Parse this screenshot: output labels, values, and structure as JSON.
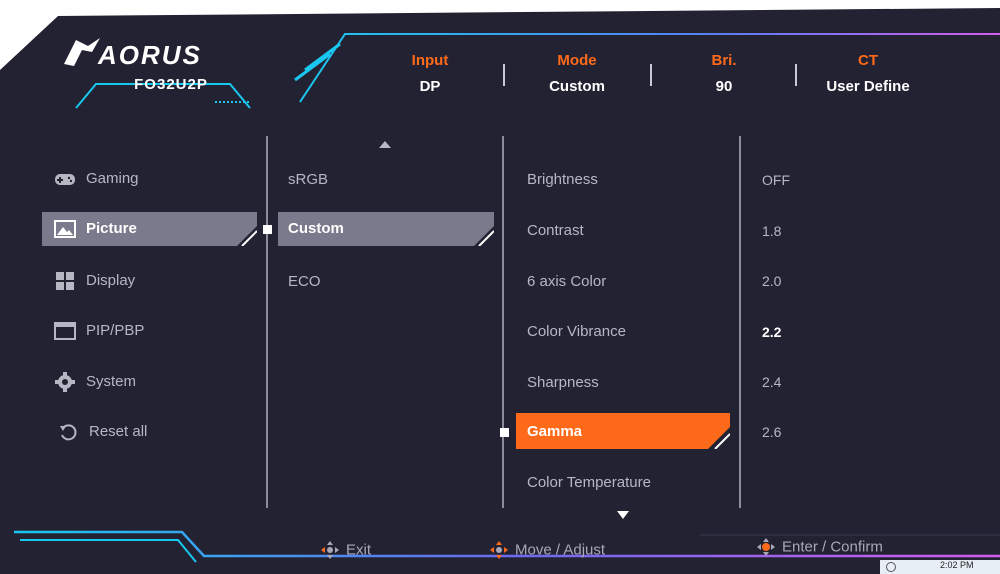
{
  "brand": {
    "logo_text": "AORUS",
    "model": "FO32U2P"
  },
  "header": {
    "items": [
      {
        "label": "Input",
        "value": "DP"
      },
      {
        "label": "Mode",
        "value": "Custom"
      },
      {
        "label": "Bri.",
        "value": "90"
      },
      {
        "label": "CT",
        "value": "User Define"
      }
    ]
  },
  "main_menu": {
    "items": [
      {
        "label": "Gaming",
        "icon": "gamepad-icon"
      },
      {
        "label": "Picture",
        "icon": "picture-icon"
      },
      {
        "label": "Display",
        "icon": "grid-icon"
      },
      {
        "label": "PIP/PBP",
        "icon": "pip-icon"
      },
      {
        "label": "System",
        "icon": "gear-icon"
      },
      {
        "label": "Reset all",
        "icon": "reset-icon"
      }
    ],
    "selected": "Picture"
  },
  "picture_modes": {
    "items": [
      "sRGB",
      "Custom",
      "ECO"
    ],
    "selected": "Custom"
  },
  "settings": {
    "items": [
      "Brightness",
      "Contrast",
      "6 axis Color",
      "Color Vibrance",
      "Sharpness",
      "Gamma",
      "Color Temperature"
    ],
    "selected": "Gamma"
  },
  "gamma_options": {
    "items": [
      "OFF",
      "1.8",
      "2.0",
      "2.2",
      "2.4",
      "2.6"
    ],
    "current": "2.2"
  },
  "footer": {
    "exit": "Exit",
    "move": "Move / Adjust",
    "enter": "Enter / Confirm"
  },
  "taskbar": {
    "time": "2:02 PM"
  },
  "colors": {
    "background": "#232232",
    "accent_orange": "#ff6a1a",
    "accent_cyan": "#19c8f0",
    "accent_magenta": "#d45cf0",
    "selected_gray": "#7a7a8c"
  }
}
